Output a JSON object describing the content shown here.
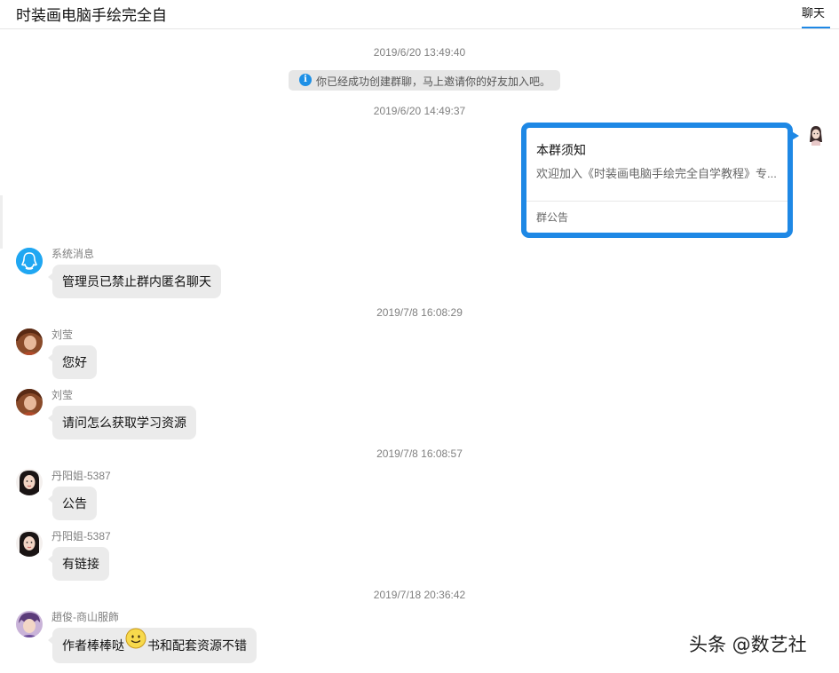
{
  "header": {
    "title": "时装画电脑手绘完全自",
    "tab_chat": "聊天"
  },
  "timestamps": [
    "2019/6/20 13:49:40",
    "2019/6/20 14:49:37",
    "2019/7/8 16:08:29",
    "2019/7/8 16:08:57",
    "2019/7/18 20:36:42"
  ],
  "system_tip": {
    "icon": "info-icon",
    "text": "你已经成功创建群聊，马上邀请你的好友加入吧。"
  },
  "notice_card": {
    "title": "本群须知",
    "body": "欢迎加入《时装画电脑手绘完全自学教程》专...",
    "footer": "群公告",
    "accent_color": "#1e88e5"
  },
  "messages": [
    {
      "sender": "系统消息",
      "text": "管理员已禁止群内匿名聊天",
      "avatar": "qq-penguin-icon"
    },
    {
      "sender": "刘莹",
      "text": "您好",
      "avatar": "user-photo"
    },
    {
      "sender": "刘莹",
      "text": "请问怎么获取学习资源",
      "avatar": "user-photo"
    },
    {
      "sender": "丹阳姐-5387",
      "text": "公告",
      "avatar": "user-photo"
    },
    {
      "sender": "丹阳姐-5387",
      "text": "有链接",
      "avatar": "user-photo"
    },
    {
      "sender": "趙俊-商山服飾",
      "text_before": "作者棒棒哒",
      "emoji": "smile-emoji-icon",
      "text_after": "书和配套资源不错",
      "avatar": "user-photo"
    }
  ],
  "watermark": "头条 @数艺社"
}
